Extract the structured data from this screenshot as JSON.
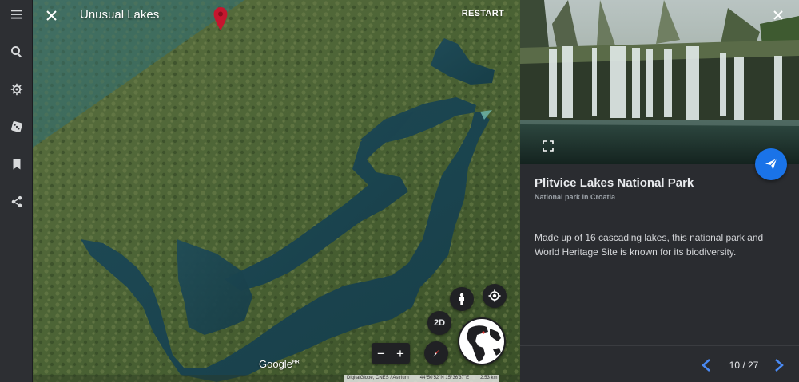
{
  "tour": {
    "title": "Unusual Lakes",
    "restart_label": "RESTART"
  },
  "sidebar": {
    "items": [
      {
        "name": "menu-icon"
      },
      {
        "name": "search-icon"
      },
      {
        "name": "voyager-icon"
      },
      {
        "name": "dice-icon"
      },
      {
        "name": "bookmark-icon"
      },
      {
        "name": "share-icon"
      }
    ]
  },
  "map": {
    "view_toggle_label": "2D",
    "zoom_out_label": "−",
    "zoom_in_label": "+",
    "logo_text": "Google",
    "logo_badge": "HR",
    "attribution": "DigitalGlobe, CNES / Astrium",
    "coordinates": "44°50'52\"N 15°36'37\"E",
    "scale": "2.53 km",
    "pin_color": "#c5162e"
  },
  "card": {
    "title": "Plitvice Lakes National Park",
    "subtitle": "National park in Croatia",
    "description": "Made up of 16 cascading lakes, this national park and World Heritage Site is known for its biodiversity.",
    "pager": "10 / 27",
    "accent_color": "#1a73e8"
  }
}
